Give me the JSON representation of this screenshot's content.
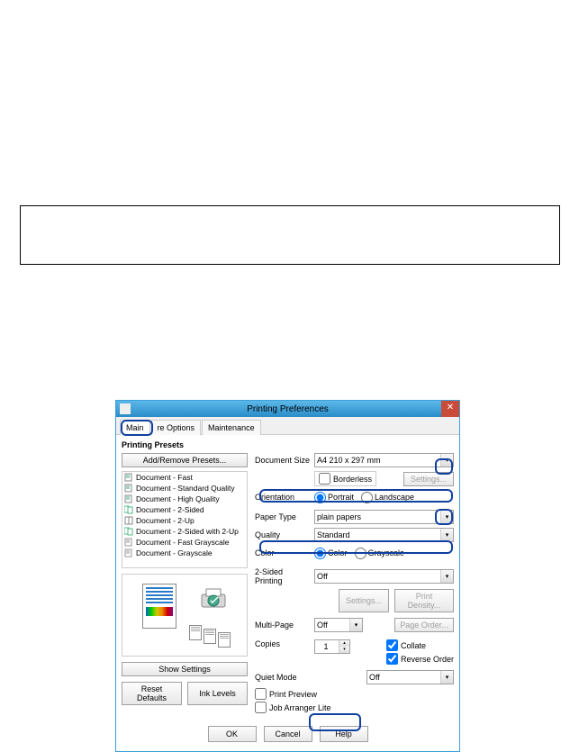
{
  "titlebar": {
    "title": "Printing Preferences",
    "close": "✕"
  },
  "tabs": {
    "main": "Main",
    "more_options_visible": "re Options",
    "maintenance": "Maintenance"
  },
  "presets": {
    "heading": "Printing Presets",
    "add_remove": "Add/Remove Presets...",
    "items": [
      "Document - Fast",
      "Document - Standard Quality",
      "Document - High Quality",
      "Document - 2-Sided",
      "Document - 2-Up",
      "Document - 2-Sided with 2-Up",
      "Document - Fast Grayscale",
      "Document - Grayscale"
    ],
    "show_settings": "Show Settings",
    "reset_defaults": "Reset Defaults",
    "ink_levels": "Ink Levels"
  },
  "form": {
    "document_size": {
      "label": "Document Size",
      "value": "A4 210 x 297 mm"
    },
    "borderless": {
      "label": "Borderless"
    },
    "settings_btn": "Settings...",
    "orientation": {
      "label": "Orientation",
      "portrait": "Portrait",
      "landscape": "Landscape"
    },
    "paper_type": {
      "label": "Paper Type",
      "value": "plain papers"
    },
    "quality": {
      "label": "Quality",
      "value": "Standard"
    },
    "color": {
      "label": "Color",
      "color_opt": "Color",
      "grayscale_opt": "Grayscale"
    },
    "two_sided": {
      "label": "2-Sided Printing",
      "value": "Off"
    },
    "two_sided_settings": "Settings...",
    "print_density": "Print Density...",
    "multi_page": {
      "label": "Multi-Page",
      "value": "Off"
    },
    "page_order": "Page Order...",
    "copies": {
      "label": "Copies",
      "value": "1"
    },
    "collate": "Collate",
    "reverse_order": "Reverse Order",
    "quiet_mode": {
      "label": "Quiet Mode",
      "value": "Off"
    },
    "print_preview": "Print Preview",
    "job_arranger": "Job Arranger Lite"
  },
  "buttons": {
    "ok": "OK",
    "cancel": "Cancel",
    "help": "Help"
  }
}
